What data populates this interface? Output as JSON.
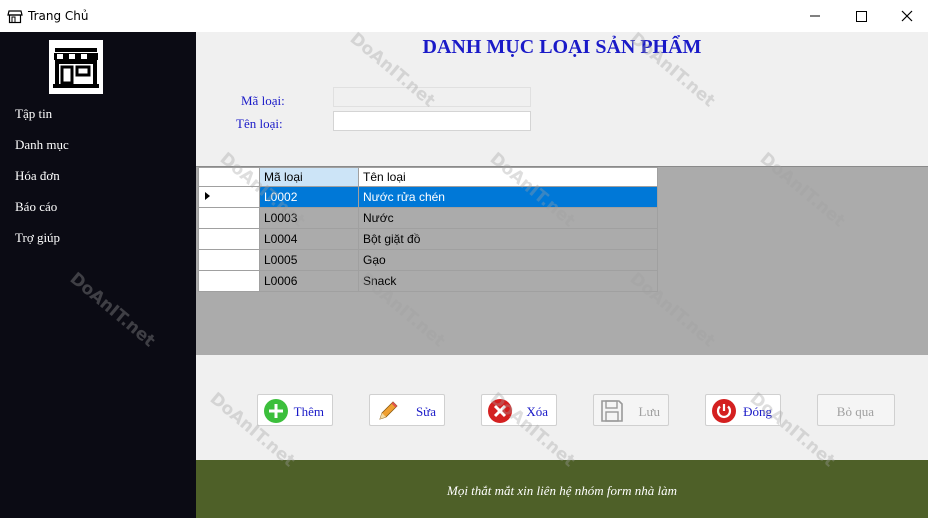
{
  "window": {
    "title": "Trang Chủ"
  },
  "sidebar": {
    "items": [
      {
        "label": "Tập tin"
      },
      {
        "label": "Danh mục"
      },
      {
        "label": "Hóa đơn"
      },
      {
        "label": "Báo cáo"
      },
      {
        "label": "Trợ giúp"
      }
    ]
  },
  "form": {
    "heading": "DANH MỤC LOẠI SẢN PHẨM",
    "ma_loai_label": "Mã loại:",
    "ma_loai_value": "",
    "ten_loai_label": "Tên loại:",
    "ten_loai_value": ""
  },
  "grid": {
    "columns": [
      "Mã loại",
      "Tên loại"
    ],
    "rows": [
      {
        "ma": "L0002",
        "ten": "Nước rửa chén",
        "selected": true
      },
      {
        "ma": "L0003",
        "ten": "Nước"
      },
      {
        "ma": "L0004",
        "ten": "Bột giặt đồ"
      },
      {
        "ma": "L0005",
        "ten": "Gạo"
      },
      {
        "ma": "L0006",
        "ten": "Snack"
      }
    ]
  },
  "buttons": {
    "them": "Thêm",
    "sua": "Sửa",
    "xoa": "Xóa",
    "luu": "Lưu",
    "dong": "Đóng",
    "bo_qua": "Bỏ qua"
  },
  "footer": {
    "text": "Mọi thắt mắt xin liên hệ nhóm form nhà làm"
  },
  "watermark": {
    "text": "DoAnIT.net"
  },
  "colors": {
    "label_blue": "#1a1ac8",
    "selection": "#0078d7",
    "footer_bg": "#4e6028",
    "sidebar_bg": "#0b0b14"
  }
}
